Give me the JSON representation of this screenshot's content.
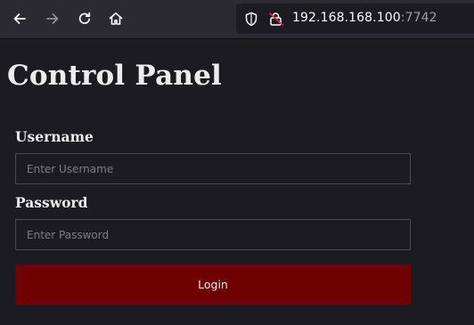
{
  "browser": {
    "url_host": "192.168.168.100",
    "url_port": ":7742",
    "icons": {
      "back": "back-arrow-icon",
      "forward": "forward-arrow-icon",
      "reload": "reload-icon",
      "home": "home-icon",
      "tracking": "shield-icon",
      "security": "insecure-lock-icon"
    }
  },
  "page": {
    "title": "Control Panel",
    "username_label": "Username",
    "username_placeholder": "Enter Username",
    "username_value": "",
    "password_label": "Password",
    "password_placeholder": "Enter Password",
    "password_value": "",
    "login_label": "Login"
  },
  "colors": {
    "background": "#1c1b22",
    "toolbar": "#2b2a33",
    "login_button": "#6e0000",
    "insecure_slash": "#e22850"
  }
}
